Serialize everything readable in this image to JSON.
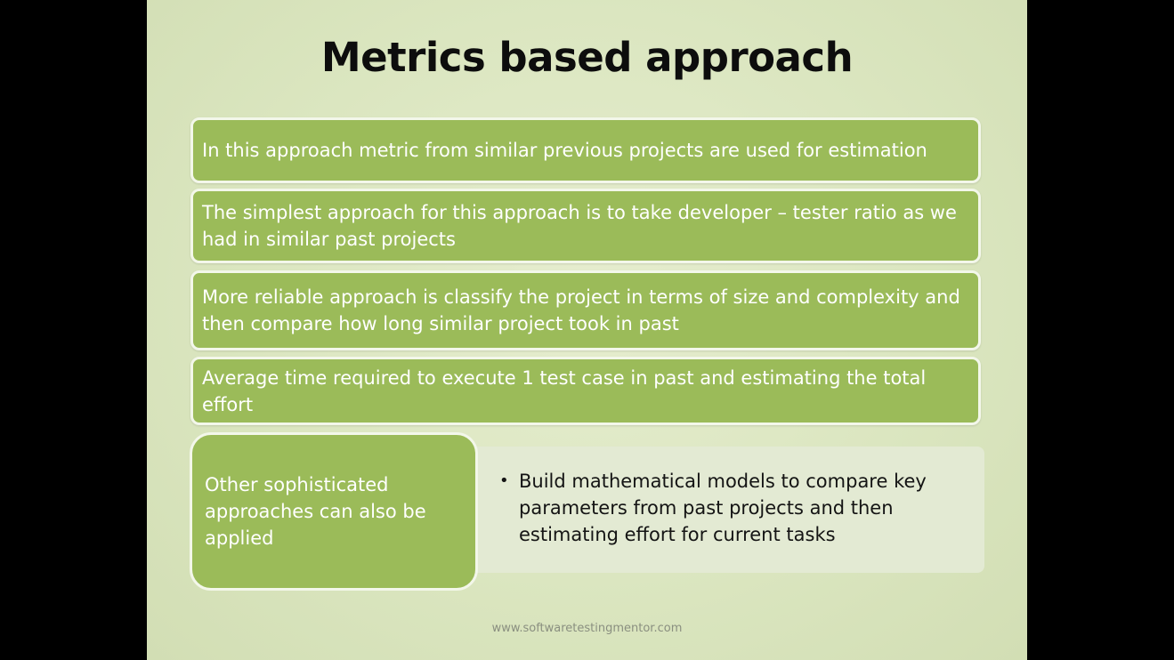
{
  "slide": {
    "title": "Metrics based approach",
    "boxes": [
      "In this approach metric from similar previous projects are used for estimation",
      "The simplest approach for this approach is to take developer – tester ratio as we had in similar past projects",
      "More reliable approach is classify the project in terms of size and complexity and then compare how long similar project took in past",
      "Average time required to execute 1 test case in past and estimating the total effort"
    ],
    "lower_left": "Other sophisticated approaches can also be applied",
    "lower_right_bullet": "Build mathematical models to compare key parameters from past projects and then estimating effort for current tasks",
    "bullet_glyph": "•",
    "footer": "www.softwaretestingmentor.com"
  },
  "colors": {
    "box_fill": "#9bbb59",
    "slide_bg": "#dbe6c0",
    "letterbox": "#000000"
  }
}
